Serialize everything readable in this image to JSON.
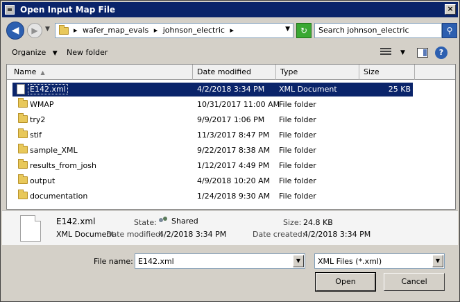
{
  "window": {
    "title": "Open Input Map File",
    "close_label": "×"
  },
  "nav": {
    "breadcrumbs": [
      "▸",
      "wafer_map_evals",
      "▸",
      "johnson_electric",
      "▸"
    ],
    "search_placeholder": "Search johnson_electric"
  },
  "toolbar": {
    "organize_label": "Organize",
    "new_folder_label": "New folder"
  },
  "columns": {
    "name": "Name",
    "date": "Date modified",
    "type": "Type",
    "size": "Size"
  },
  "files": [
    {
      "name": "E142.xml",
      "date": "4/2/2018 3:34 PM",
      "type": "XML Document",
      "size": "25 KB",
      "kind": "file",
      "selected": true
    },
    {
      "name": "WMAP",
      "date": "10/31/2017 11:00 AM",
      "type": "File folder",
      "size": "",
      "kind": "folder"
    },
    {
      "name": "try2",
      "date": "9/9/2017 1:06 PM",
      "type": "File folder",
      "size": "",
      "kind": "folder"
    },
    {
      "name": "stif",
      "date": "11/3/2017 8:47 PM",
      "type": "File folder",
      "size": "",
      "kind": "folder"
    },
    {
      "name": "sample_XML",
      "date": "9/22/2017 8:38 AM",
      "type": "File folder",
      "size": "",
      "kind": "folder"
    },
    {
      "name": "results_from_josh",
      "date": "1/12/2017 4:49 PM",
      "type": "File folder",
      "size": "",
      "kind": "folder"
    },
    {
      "name": "output",
      "date": "4/9/2018 10:20 AM",
      "type": "File folder",
      "size": "",
      "kind": "folder"
    },
    {
      "name": "documentation",
      "date": "1/24/2018 9:30 AM",
      "type": "File folder",
      "size": "",
      "kind": "folder"
    }
  ],
  "details": {
    "filename": "E142.xml",
    "filetype": "XML Document",
    "state_label": "State:",
    "state_value": "Shared",
    "size_label": "Size:",
    "size_value": "24.8 KB",
    "modified_label": "Date modified:",
    "modified_value": "4/2/2018 3:34 PM",
    "created_label": "Date created:",
    "created_value": "4/2/2018 3:34 PM"
  },
  "footer": {
    "file_name_label": "File name:",
    "file_name_value": "E142.xml",
    "filter_value": "XML Files (*.xml)",
    "open_label": "Open",
    "cancel_label": "Cancel"
  },
  "colors": {
    "titlebar": "#0a246a",
    "selection": "#0a246a",
    "face": "#d4d0c8"
  }
}
